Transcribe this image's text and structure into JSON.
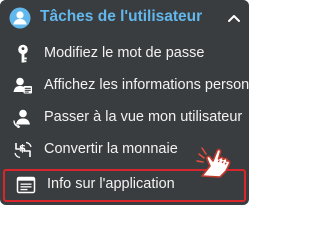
{
  "menu": {
    "header": {
      "title": "Tâches de l'utilisateur",
      "icon": "user-tasks-icon",
      "chevron": "chevron-up-icon",
      "accent_color": "#62b7ec"
    },
    "items": [
      {
        "label": "Modifiez le mot de passe",
        "icon": "key-icon"
      },
      {
        "label": "Affichez les informations person...",
        "icon": "user-info-icon"
      },
      {
        "label": "Passer à la vue mon utilisateur",
        "icon": "user-switch-icon"
      },
      {
        "label": "Convertir la monnaie",
        "icon": "currency-convert-icon"
      },
      {
        "label": "Info sur l'application",
        "icon": "app-info-icon",
        "highlighted": true
      }
    ],
    "highlight_color": "#d9262c",
    "cursor": "pointing-hand-icon"
  }
}
